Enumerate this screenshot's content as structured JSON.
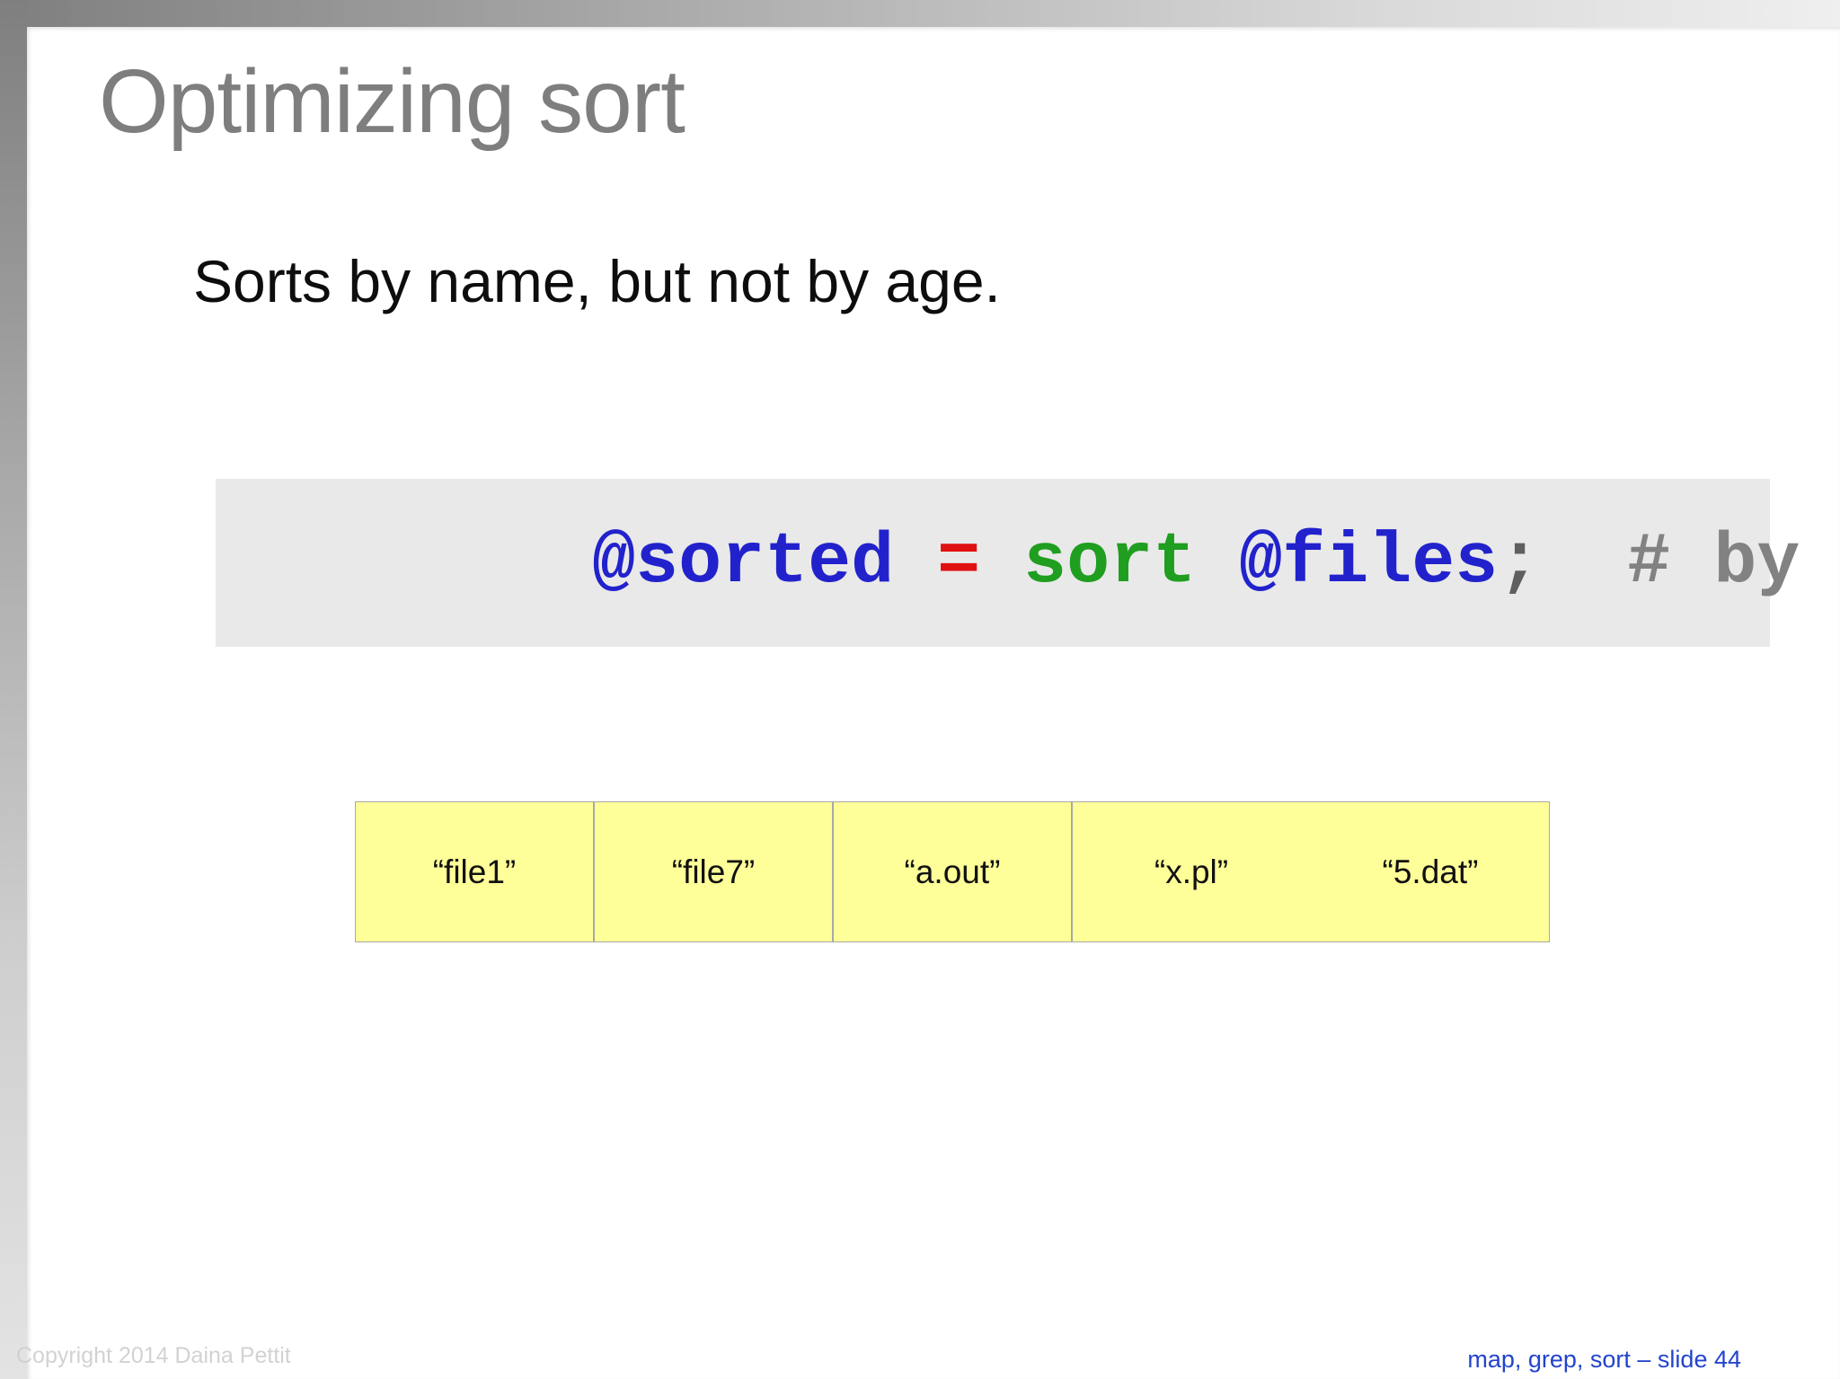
{
  "slide": {
    "title": "Optimizing sort",
    "subtitle": "Sorts by name, but not by age.",
    "code_block": {
      "background": "#e9e9e9",
      "tokens": [
        {
          "text": "@sorted",
          "color": "#2222cc"
        },
        {
          "text": " ",
          "color": "#808080"
        },
        {
          "text": "=",
          "color": "#e01010"
        },
        {
          "text": " ",
          "color": "#808080"
        },
        {
          "text": "sort",
          "color": "#1f9e1f"
        },
        {
          "text": " ",
          "color": "#808080"
        },
        {
          "text": "@files",
          "color": "#2222cc"
        },
        {
          "text": ";",
          "color": "#5f5f5f"
        },
        {
          "text": "  # by name",
          "color": "#828282"
        }
      ]
    },
    "files_table": {
      "fill_color": "#ffff99",
      "cells": [
        "“file1”",
        "“file7”",
        "“a.out”",
        "“x.pl”",
        "“5.dat”"
      ]
    },
    "footer": {
      "text": "map, grep, sort – slide 44",
      "color": "#2244cc"
    },
    "copyright": "Copyright 2014 Daina Pettit"
  }
}
